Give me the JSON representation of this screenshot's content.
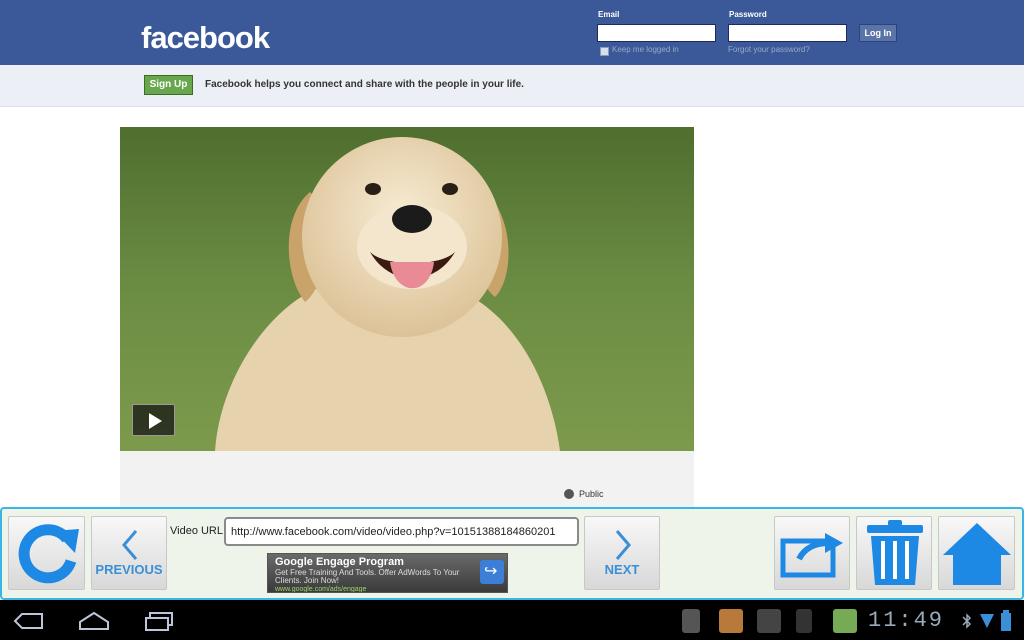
{
  "header": {
    "logo": "facebook",
    "email_label": "Email",
    "password_label": "Password",
    "login_button": "Log In",
    "keep_logged_in": "Keep me logged in",
    "forgot_password": "Forgot your password?"
  },
  "subbar": {
    "signup_button": "Sign Up",
    "tagline": "Facebook helps you connect and share with the people in your life."
  },
  "post": {
    "privacy": "Public"
  },
  "toolbar": {
    "previous_label": "PREVIOUS",
    "next_label": "NEXT",
    "url_label": "Video URL",
    "url_value": "http://www.facebook.com/video/video.php?v=10151388184860201"
  },
  "ad": {
    "title": "Google Engage Program",
    "description": "Get Free Training And Tools. Offer AdWords To Your Clients. Join Now!",
    "url": "www.google.com/ads/engage"
  },
  "statusbar": {
    "time": "11:49"
  },
  "colors": {
    "facebook_blue": "#3b5998",
    "toolbar_border": "#39b6e6",
    "icon_blue": "#1e88e5"
  }
}
